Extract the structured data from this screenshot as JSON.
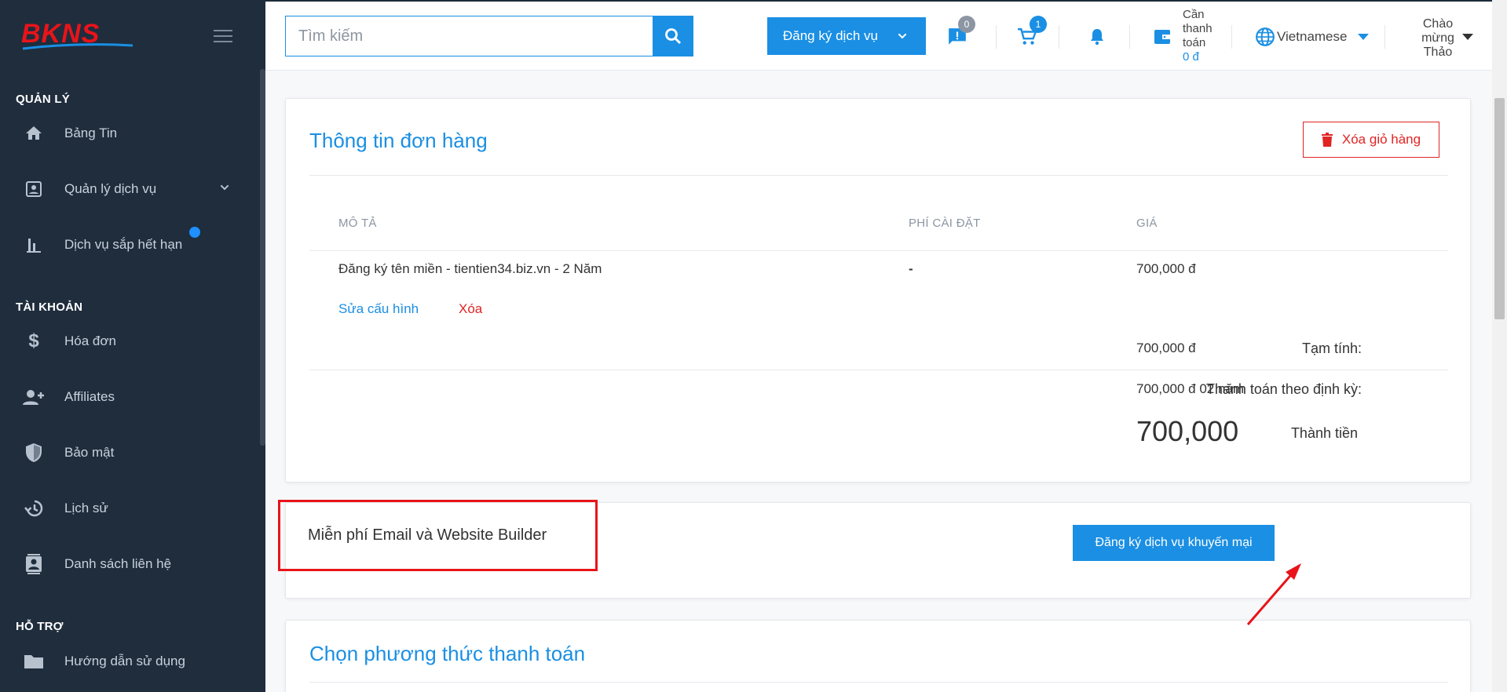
{
  "brand": {
    "logo_text": "BKNS",
    "logo_color": "#e8141a",
    "logo_accent": "#1a8fe3"
  },
  "sidebar": {
    "sections": [
      {
        "title": "QUẢN LÝ"
      },
      {
        "title": "TÀI KHOẢN"
      },
      {
        "title": "HỖ TRỢ"
      }
    ],
    "items": [
      {
        "label": "Bảng Tin",
        "icon": "home-icon"
      },
      {
        "label": "Quản lý dịch vụ",
        "icon": "account-box-icon"
      },
      {
        "label": "Dịch vụ sắp hết hạn",
        "icon": "bar-chart-icon"
      },
      {
        "label": "Hóa đơn",
        "icon": "dollar-icon"
      },
      {
        "label": "Affiliates",
        "icon": "add-user-icon"
      },
      {
        "label": "Bảo mật",
        "icon": "shield-icon"
      },
      {
        "label": "Lịch sử",
        "icon": "history-icon"
      },
      {
        "label": "Danh sách liên hệ",
        "icon": "contacts-icon"
      },
      {
        "label": "Hướng dẫn sử dụng",
        "icon": "folder-icon"
      }
    ]
  },
  "topbar": {
    "search_placeholder": "Tìm kiếm",
    "register_label": "Đăng ký dịch vụ",
    "messages_count": "0",
    "cart_count": "1",
    "pay_label": "Cần thanh toán",
    "pay_amount": "0 đ",
    "language": "Vietnamese",
    "greeting": "Chào mừng Thảo"
  },
  "order": {
    "title": "Thông tin đơn hàng",
    "clear_cart_label": "Xóa giỏ hàng",
    "columns": [
      "MÔ TẢ",
      "PHÍ CÀI ĐẶT",
      "GIÁ"
    ],
    "rows": [
      {
        "description": "Đăng ký tên miền - tientien34.biz.vn - 2 Năm",
        "setup_fee": "-",
        "price": "700,000 đ"
      }
    ],
    "edit_label": "Sửa cấu hình",
    "delete_label": "Xóa",
    "subtotal_label": "Tạm tính:",
    "subtotal_value": "700,000 đ",
    "recurring_label": "Thanh toán theo định kỳ:",
    "recurring_value": "700,000 đ 02 năm",
    "total_label": "Thành tiền",
    "total_value": "700,000"
  },
  "promo": {
    "text": "Miễn phí Email và Website Builder",
    "button_label": "Đăng ký dịch vụ khuyến mại"
  },
  "payment": {
    "title": "Chọn phương thức thanh toán"
  },
  "colors": {
    "primary": "#1a8fe3",
    "danger": "#e02424",
    "sidebar_bg": "#1f2d3d",
    "annotation": "#e8141a"
  }
}
